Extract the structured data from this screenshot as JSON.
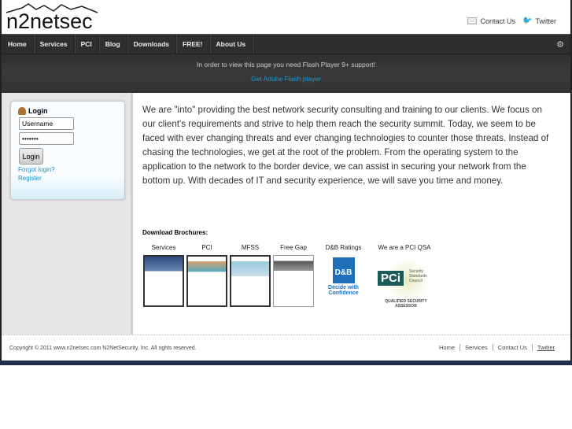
{
  "header": {
    "logo": "n2netsec",
    "contact": "Contact Us",
    "twitter": "Twitter"
  },
  "nav": [
    "Home",
    "Services",
    "PCI",
    "Blog",
    "Downloads",
    "FREE!",
    "About Us"
  ],
  "flash": {
    "message": "In order to view this page you need Flash Player 9+ support!",
    "link": "Get Adobe Flash player"
  },
  "login": {
    "title": "Login",
    "username": "Username",
    "password": "•••••••",
    "button": "Login",
    "forgot": "Forgot login?",
    "register": "Register"
  },
  "intro": "We are \"into\" providing the best network security consulting and training to our clients. We focus on our client's requirements and strive to help them reach the security summit. Today, we seem to be faced with ever changing threats and ever changing technologies to counter those threats. Instead of chasing the technologies, we get at the root of the problem. From the operating system to the application to the network to the border device, we can assist in securing your network from the bottom up. With decades of IT and security experience, we will save you time and money.",
  "brochures": {
    "heading": "Download Brochures:",
    "items": [
      "Services",
      "PCI",
      "MFSS",
      "Free Gap",
      "D&B Ratings",
      "We are a PCI QSA"
    ],
    "dnb_tag": "Decide with Confidence",
    "dnb_logo": "D&B",
    "pci_logo": "PCi",
    "pci_council": "Security Standards Council",
    "pci_qsa": "QUALIFIED SECURITY ASSESSOR"
  },
  "footer": {
    "copyright": "Copyright © 2011 www.n2netsec.com N2NetSecurity, Inc. All rights reserved.",
    "links": [
      "Home",
      "Services",
      "Contact Us",
      "Twitter"
    ]
  }
}
